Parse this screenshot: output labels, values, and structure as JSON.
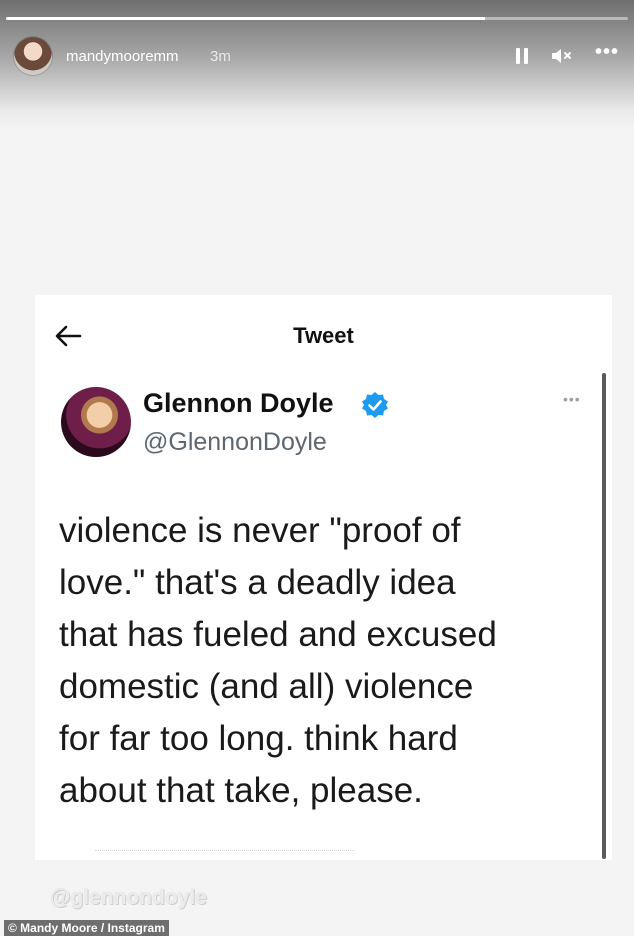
{
  "story": {
    "progress": 0.77,
    "username": "mandymooremm",
    "time_ago": "3m",
    "controls": {
      "pause_icon": "pause-icon",
      "mute_icon": "volume-muted-icon",
      "more_icon": "more-icon",
      "more_glyph": "•••"
    },
    "watermark": "@glennondoyle",
    "credit": "© Mandy Moore / Instagram"
  },
  "tweet": {
    "header_title": "Tweet",
    "back_icon": "back-arrow-icon",
    "author": {
      "display_name": "Glennon Doyle",
      "handle": "@GlennonDoyle",
      "verified": true,
      "verified_color": "#1d9bf0"
    },
    "more_glyph": "•••",
    "text_lines": [
      "violence is never \"proof of",
      "love.\" that's a deadly idea",
      "that has fueled and excused",
      "domestic (and all) violence",
      "for far too long. think hard",
      "about that take, please."
    ]
  }
}
